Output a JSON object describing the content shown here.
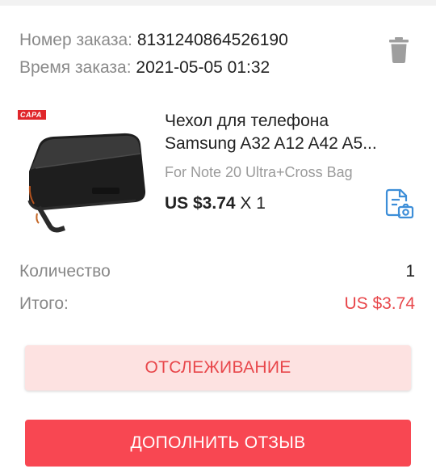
{
  "order": {
    "number_label": "Номер заказа:",
    "number_value": "8131240864526190",
    "time_label": "Время заказа:",
    "time_value": "2021-05-05 01:32"
  },
  "product": {
    "badge": "CAPA",
    "title_line1": "Чехол для телефона",
    "title_line2": "Samsung A32 A12 A42 A5...",
    "variant": "For Note 20 Ultra+Cross Bag",
    "price": "US $3.74",
    "quantity_mult": "X 1"
  },
  "summary": {
    "quantity_label": "Количество",
    "quantity_value": "1",
    "total_label": "Итого:",
    "total_value": "US $3.74"
  },
  "buttons": {
    "track": "ОТСЛЕЖИВАНИЕ",
    "review": "ДОПОЛНИТЬ ОТЗЫВ"
  },
  "icons": {
    "delete": "trash-icon",
    "snapshot": "order-snapshot-icon"
  },
  "colors": {
    "accent": "#e8474b",
    "button_primary": "#f84752",
    "button_secondary_bg": "#fde2e1",
    "icon_blue": "#3d8ed8",
    "trash_gray": "#9e9e9e"
  }
}
